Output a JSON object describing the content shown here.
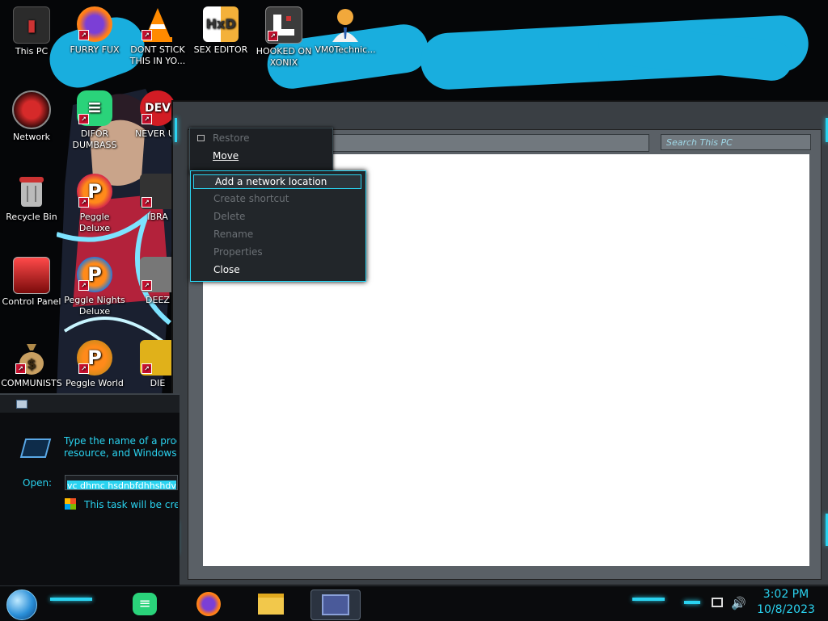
{
  "desktop_icons": [
    {
      "label": "This PC",
      "icon": "computer-icon"
    },
    {
      "label": "FURRY FUX",
      "icon": "firefox-icon"
    },
    {
      "label": "DONT STICK THIS IN YO...",
      "icon": "vlc-icon"
    },
    {
      "label": "SEX EDITOR",
      "icon": "hex-editor-icon"
    },
    {
      "label": "HOOKED ON XONIX",
      "icon": "xonix-icon"
    },
    {
      "label": "VM0Technic...",
      "icon": "person-icon"
    },
    {
      "label": "Network",
      "icon": "network-icon"
    },
    {
      "label": "DIFOR DUMBASS",
      "icon": "chat-icon"
    },
    {
      "label": "NEVER US",
      "icon": "dev-icon"
    },
    {
      "label": "Recycle Bin",
      "icon": "recycle-bin-icon"
    },
    {
      "label": "Peggle Deluxe",
      "icon": "peggle-icon"
    },
    {
      "label": "IBRA",
      "icon": "app-icon"
    },
    {
      "label": "Control Panel",
      "icon": "control-panel-icon"
    },
    {
      "label": "Peggle Nights Deluxe",
      "icon": "peggle-icon"
    },
    {
      "label": "DEEZ",
      "icon": "app-icon"
    },
    {
      "label": "COMMUNISTS",
      "icon": "money-bag-icon"
    },
    {
      "label": "Peggle World",
      "icon": "peggle-icon"
    },
    {
      "label": "DIE",
      "icon": "app-icon"
    }
  ],
  "explorer": {
    "search_placeholder": "Search This PC"
  },
  "context_menu": {
    "items": [
      {
        "label": "Restore",
        "enabled": false
      },
      {
        "label": "Move",
        "enabled": true
      }
    ],
    "submenu": [
      {
        "label": "Add a network location",
        "enabled": true,
        "selected": true
      },
      {
        "label": "Create shortcut",
        "enabled": false
      },
      {
        "label": "Delete",
        "enabled": false
      },
      {
        "label": "Rename",
        "enabled": false
      },
      {
        "label": "Properties",
        "enabled": false
      },
      {
        "label": "Close",
        "enabled": true
      }
    ]
  },
  "run_dialog": {
    "prompt": "Type the name of a progra\nresource, and Windows w",
    "open_label": "Open:",
    "open_value": "vc dhmc hsdnbfdhhshdv",
    "note": "This task will be creat"
  },
  "taskbar": {
    "items": [
      "chat-icon",
      "firefox-icon",
      "file-explorer-icon",
      "run-icon"
    ],
    "time": "3:02 PM",
    "date": "10/8/2023"
  },
  "colors": {
    "accent": "#2ad3f0",
    "wallpaper_blue": "#19aede"
  }
}
